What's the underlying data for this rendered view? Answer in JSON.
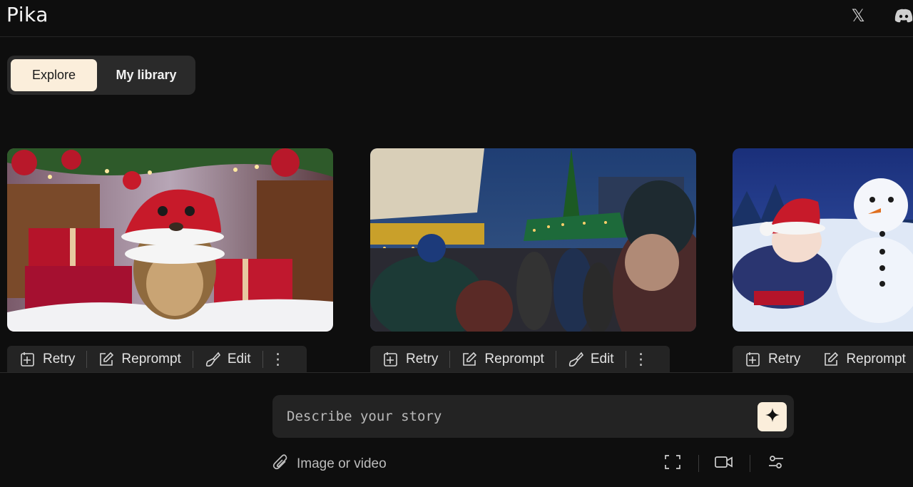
{
  "header": {
    "logo": "Pika",
    "x_icon_glyph": "𝕏"
  },
  "tabs": [
    {
      "label": "Explore",
      "active": true
    },
    {
      "label": "My library",
      "active": false
    }
  ],
  "card_actions": {
    "retry": "Retry",
    "reprompt": "Reprompt",
    "edit": "Edit",
    "more": "⋮"
  },
  "prompt": {
    "placeholder": "Describe your story",
    "attach_label": "Image or video"
  },
  "colors": {
    "accent": "#fbeedb",
    "background": "#0e0e0e",
    "panel": "#242424"
  },
  "icons": [
    "x-icon",
    "discord-icon",
    "retry-icon",
    "reprompt-icon",
    "edit-brush-icon",
    "more-vertical-icon",
    "sparkle-icon",
    "paperclip-icon",
    "aspect-ratio-icon",
    "video-camera-icon",
    "settings-sliders-icon"
  ]
}
